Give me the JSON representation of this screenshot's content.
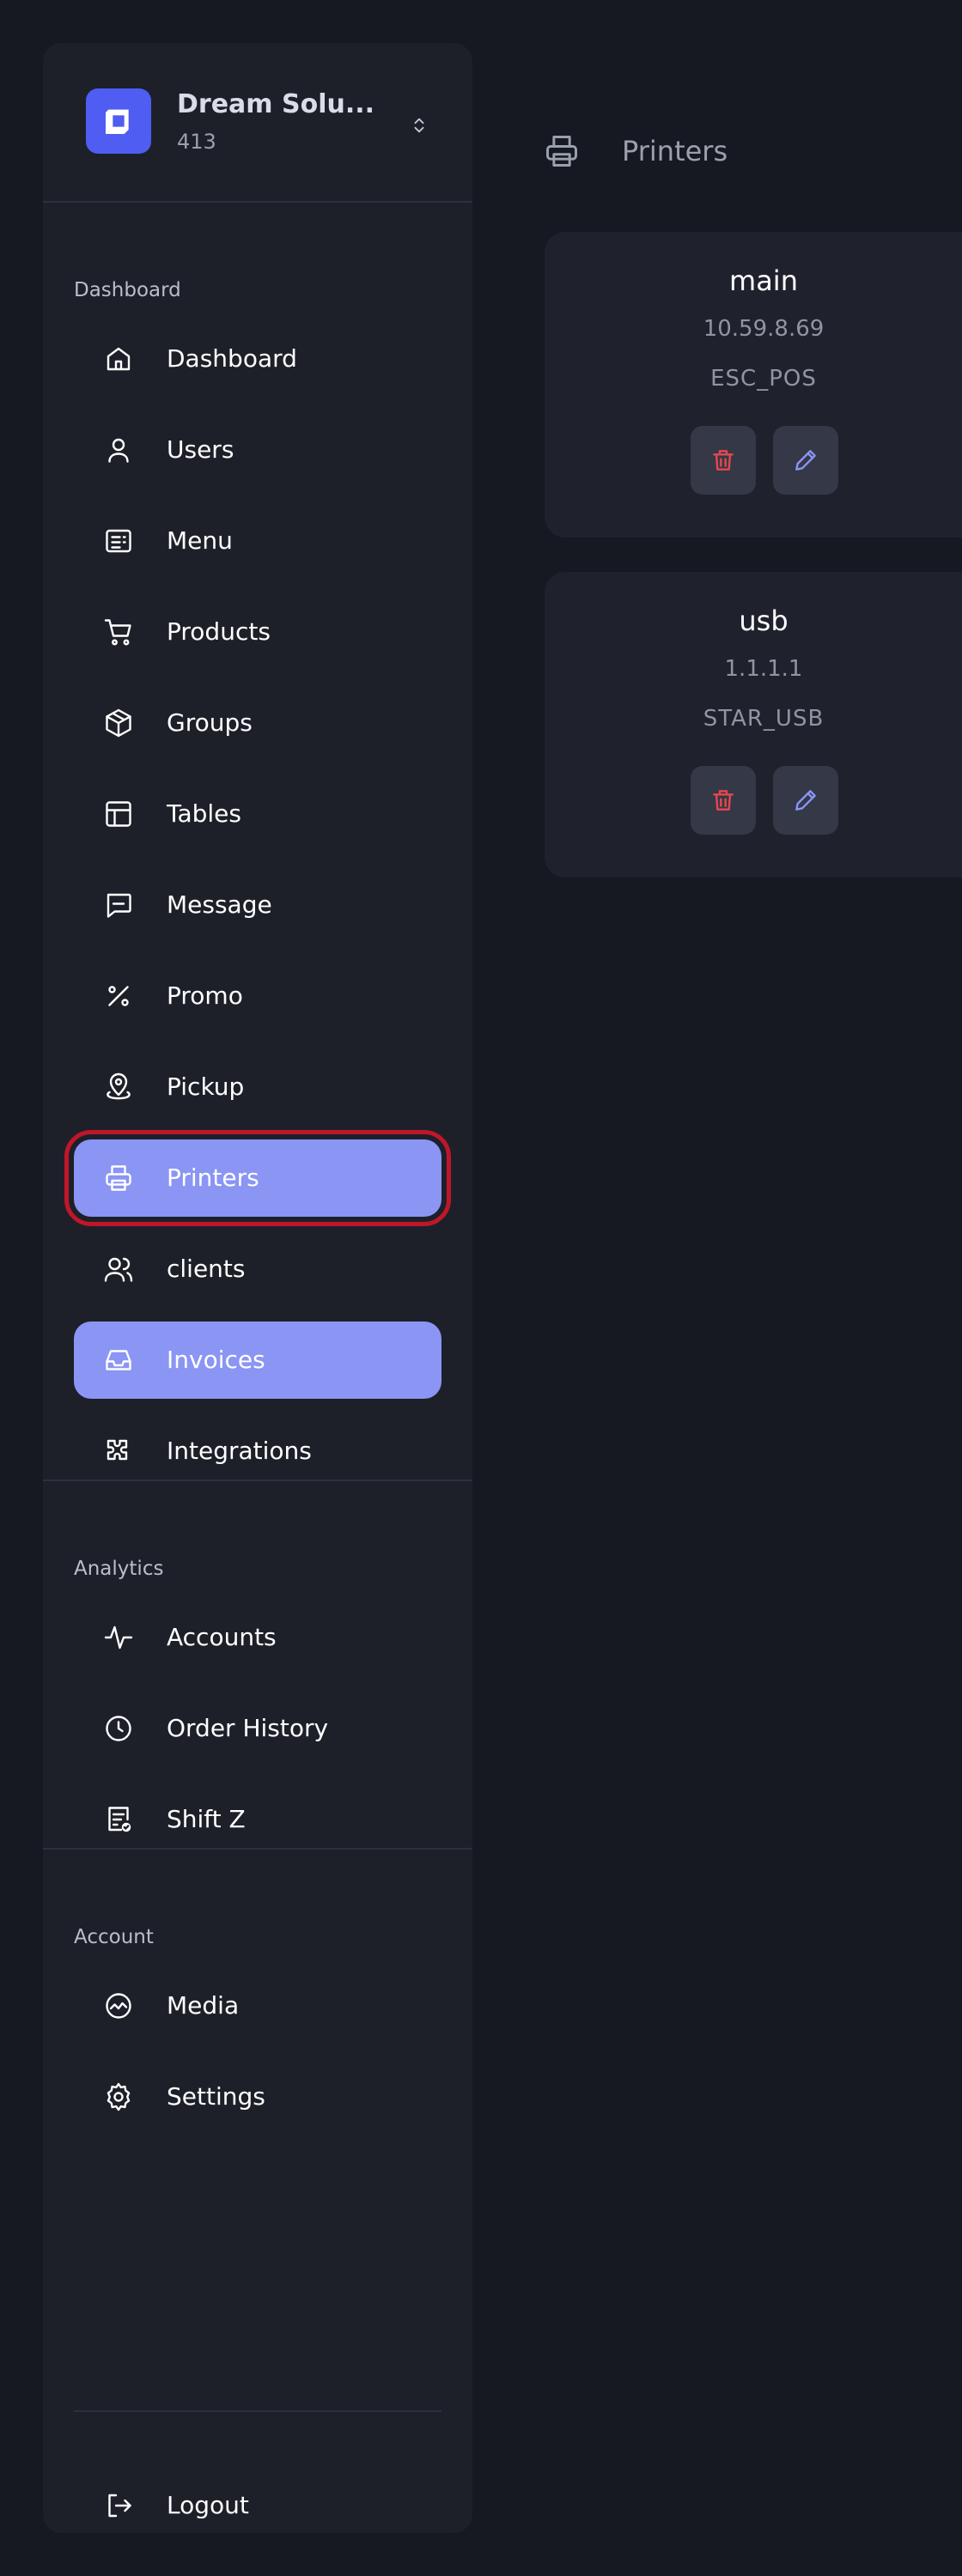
{
  "brand": {
    "name": "Dream Solu...",
    "id": "413",
    "logo_icon": "square-logo-icon",
    "switch_icon": "chevron-up-down-icon"
  },
  "sections": {
    "dashboard": "Dashboard",
    "analytics": "Analytics",
    "account": "Account"
  },
  "nav": {
    "dashboard": {
      "label": "Dashboard",
      "icon": "home-icon"
    },
    "users": {
      "label": "Users",
      "icon": "user-icon"
    },
    "menu": {
      "label": "Menu",
      "icon": "menu-list-icon"
    },
    "products": {
      "label": "Products",
      "icon": "cart-icon"
    },
    "groups": {
      "label": "Groups",
      "icon": "box-icon"
    },
    "tables": {
      "label": "Tables",
      "icon": "table-icon"
    },
    "message": {
      "label": "Message",
      "icon": "message-icon"
    },
    "promo": {
      "label": "Promo",
      "icon": "percent-icon"
    },
    "pickup": {
      "label": "Pickup",
      "icon": "map-pin-icon"
    },
    "printers": {
      "label": "Printers",
      "icon": "printer-icon"
    },
    "clients": {
      "label": "clients",
      "icon": "users-icon"
    },
    "invoices": {
      "label": "Invoices",
      "icon": "inbox-icon"
    },
    "integrations": {
      "label": "Integrations",
      "icon": "puzzle-icon"
    },
    "accounts": {
      "label": "Accounts",
      "icon": "activity-icon"
    },
    "order_history": {
      "label": "Order History",
      "icon": "clock-icon"
    },
    "shift_z": {
      "label": "Shift Z",
      "icon": "receipt-check-icon"
    },
    "media": {
      "label": "Media",
      "icon": "media-icon"
    },
    "settings": {
      "label": "Settings",
      "icon": "gear-icon"
    },
    "logout": {
      "label": "Logout",
      "icon": "logout-icon"
    }
  },
  "header": {
    "title": "Printers",
    "icon": "printer-icon"
  },
  "printers": [
    {
      "name": "main",
      "ip": "10.59.8.69",
      "type": "ESC_POS"
    },
    {
      "name": "usb",
      "ip": "1.1.1.1",
      "type": "STAR_USB"
    }
  ],
  "colors": {
    "background": "#161922",
    "sidebar": "#1d2029",
    "card": "#1f222c",
    "accent": "#8a95f4",
    "brand": "#4f5df3",
    "delete": "#e5484d",
    "edit": "#8a95f4",
    "highlight_outline": "#c0162a"
  }
}
